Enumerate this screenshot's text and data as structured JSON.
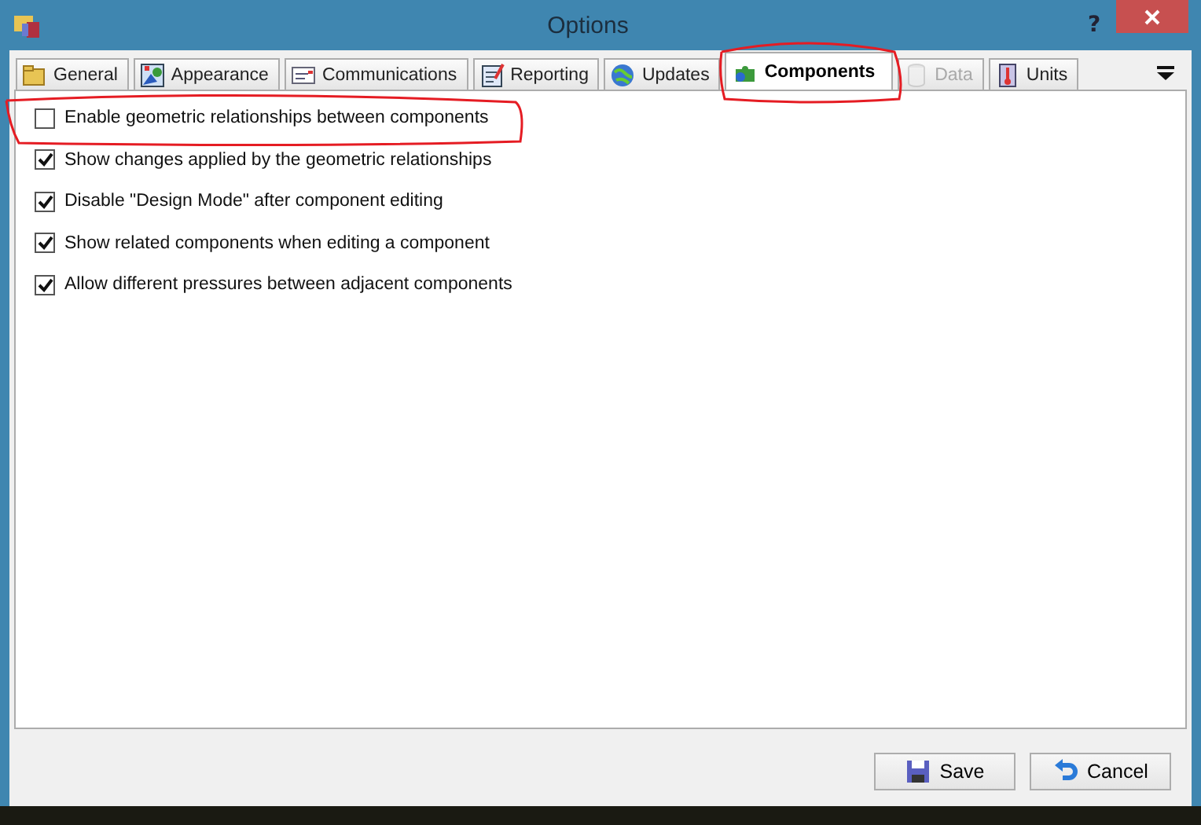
{
  "window": {
    "title": "Options",
    "help": "?"
  },
  "tabs": [
    {
      "label": "General",
      "selected": false,
      "disabled": false
    },
    {
      "label": "Appearance",
      "selected": false,
      "disabled": false
    },
    {
      "label": "Communications",
      "selected": false,
      "disabled": false
    },
    {
      "label": "Reporting",
      "selected": false,
      "disabled": false
    },
    {
      "label": "Updates",
      "selected": false,
      "disabled": false
    },
    {
      "label": "Components",
      "selected": true,
      "disabled": false
    },
    {
      "label": "Data",
      "selected": false,
      "disabled": true
    },
    {
      "label": "Units",
      "selected": false,
      "disabled": false
    }
  ],
  "options": [
    {
      "label": "Enable geometric relationships between components",
      "checked": false
    },
    {
      "label": "Show changes applied by the geometric relationships",
      "checked": true
    },
    {
      "label": "Disable \"Design Mode\" after component editing",
      "checked": true
    },
    {
      "label": "Show related components when editing a component",
      "checked": true
    },
    {
      "label": "Allow different pressures between adjacent components",
      "checked": true
    }
  ],
  "buttons": [
    {
      "label": "Save",
      "kind": "save"
    },
    {
      "label": "Cancel",
      "kind": "cancel"
    }
  ]
}
